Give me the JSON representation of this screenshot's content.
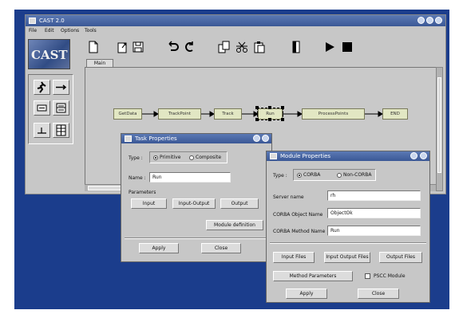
{
  "main_window": {
    "title": "CAST 2.0",
    "menu": [
      "File",
      "Edit",
      "Options",
      "Tools"
    ],
    "logo_text": "CAST",
    "tab_label": "Main"
  },
  "flow": {
    "nodes": [
      "GetData",
      "TrackPoint",
      "Track",
      "Run",
      "ProcessPoints",
      "END"
    ],
    "selected": "Run"
  },
  "task_props": {
    "title": "Task Properties",
    "type_label": "Type :",
    "type_options": [
      "Primitive",
      "Composite"
    ],
    "type_selected": "Primitive",
    "name_label": "Name :",
    "name_value": "Run",
    "parameters_label": "Parameters",
    "input_button": "Input",
    "input_output_button": "Input-Output",
    "output_button": "Output",
    "module_definition_button": "Module definition",
    "apply_button": "Apply",
    "close_button": "Close"
  },
  "module_props": {
    "title": "Module Properties",
    "type_label": "Type :",
    "type_options": [
      "CORBA",
      "Non-CORBA"
    ],
    "type_selected": "CORBA",
    "server_name_label": "Server name",
    "server_name_value": "rh",
    "object_name_label": "CORBA Object Name",
    "object_name_value": "ObjectOk",
    "method_name_label": "CORBA Method Name",
    "method_name_value": "Run",
    "input_files_button": "Input Files",
    "input_output_files_button": "Input Output Files",
    "output_files_button": "Output Files",
    "method_parameters_button": "Method Parameters",
    "pscc_module_label": "PSCC Module",
    "apply_button": "Apply",
    "close_button": "Close"
  },
  "colors": {
    "desktop": "#1b3d8c",
    "titlebar": "#4a68a5",
    "window": "#c7c7c7",
    "node": "#e2e7c3"
  }
}
